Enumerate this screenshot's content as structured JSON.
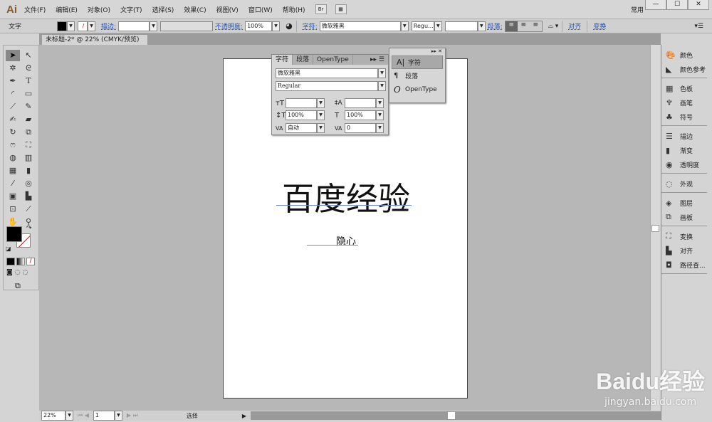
{
  "app": {
    "logo": "Ai",
    "menus": [
      "文件(F)",
      "编辑(E)",
      "对象(O)",
      "文字(T)",
      "选择(S)",
      "效果(C)",
      "视图(V)",
      "窗口(W)",
      "帮助(H)"
    ],
    "bridge": "Br",
    "workspace": "常用",
    "window_controls": [
      "—",
      "☐",
      "✕"
    ]
  },
  "control": {
    "tool_label": "文字",
    "stroke_label": "描边:",
    "opacity_label": "不透明度:",
    "opacity_value": "100%",
    "char_label": "字符:",
    "font": "微软雅黑",
    "style": "Regu...",
    "para_label": "段落:",
    "align_label": "对齐",
    "transform_label": "变换"
  },
  "doc_tab": {
    "title": "未标题-2* @ 22% (CMYK/预览)",
    "close": "×"
  },
  "artboard": {
    "title": "百度经验",
    "subtitle": "隐心"
  },
  "char_panel": {
    "tabs": [
      "字符",
      "段落",
      "OpenType"
    ],
    "font": "微软雅黑",
    "style": "Regular",
    "size": "",
    "leading": "",
    "vscale": "100%",
    "hscale": "100%",
    "kerning": "自动",
    "tracking": "0"
  },
  "flyout": {
    "items": [
      "字符",
      "段落",
      "OpenType"
    ]
  },
  "right_panel": {
    "groups": [
      [
        "颜色",
        "颜色参考"
      ],
      [
        "色板",
        "画笔",
        "符号"
      ],
      [
        "描边",
        "渐变",
        "透明度"
      ],
      [
        "外观"
      ],
      [
        "图层",
        "画板"
      ],
      [
        "变换",
        "对齐",
        "路径查..."
      ]
    ]
  },
  "status": {
    "zoom": "22%",
    "page": "1",
    "tool": "选择"
  },
  "watermark": {
    "text": "Baidu经验",
    "url": "jingyan.baidu.com"
  }
}
